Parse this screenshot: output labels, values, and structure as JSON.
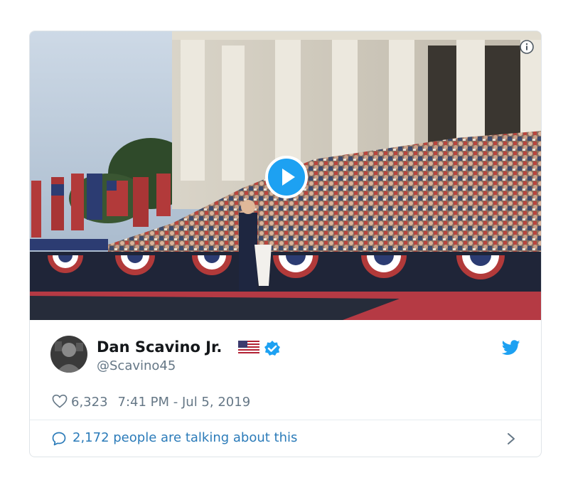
{
  "media": {
    "type": "video",
    "play_icon": "play-icon",
    "info_icon": "info-icon"
  },
  "author": {
    "name": "Dan Scavino Jr.",
    "flag_emoji": "us-flag",
    "verified": true,
    "handle": "@Scavino45"
  },
  "meta": {
    "likes": "6,323",
    "timestamp": "7:41 PM - Jul 5, 2019"
  },
  "footer": {
    "talking": "2,172 people are talking about this"
  },
  "colors": {
    "blue": "#1da1f2",
    "link": "#2b7bb9",
    "muted": "#657786",
    "text": "#14171a"
  }
}
